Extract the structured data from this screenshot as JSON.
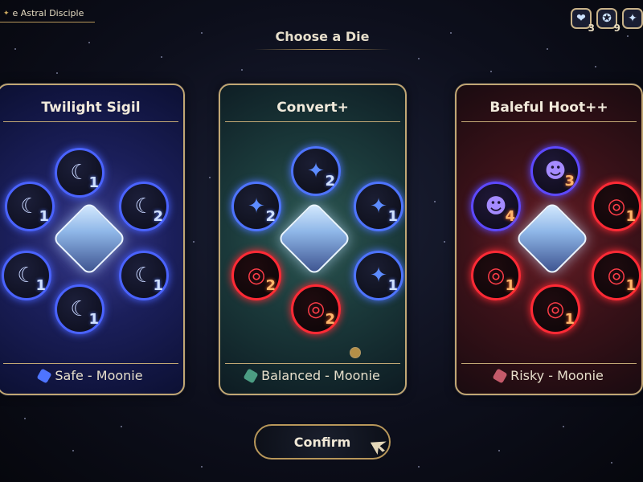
{
  "top_left_title": "e Astral Disciple",
  "resources": [
    {
      "icon": "heart-shield-icon",
      "count": "3"
    },
    {
      "icon": "coin-pouch-icon",
      "count": "9"
    },
    {
      "icon": "heart-gem-icon",
      "count": ""
    }
  ],
  "header": {
    "title": "Choose a Die"
  },
  "cards": [
    {
      "name": "Twilight Sigil",
      "footer": "Safe - Moonie",
      "faces": [
        {
          "type": "moon",
          "value": "1",
          "color": "blue"
        },
        {
          "type": "moon",
          "value": "1",
          "color": "blue"
        },
        {
          "type": "moon",
          "value": "2",
          "color": "blue"
        },
        {
          "type": "moon",
          "value": "1",
          "color": "blue"
        },
        {
          "type": "moon",
          "value": "1",
          "color": "blue"
        },
        {
          "type": "moon",
          "value": "1",
          "color": "blue"
        }
      ]
    },
    {
      "name": "Convert+",
      "footer": "Balanced - Moonie",
      "faces": [
        {
          "type": "gem",
          "value": "2",
          "color": "blue"
        },
        {
          "type": "gem",
          "value": "2",
          "color": "blue"
        },
        {
          "type": "gem",
          "value": "1",
          "color": "blue"
        },
        {
          "type": "red",
          "value": "2",
          "color": "orange"
        },
        {
          "type": "gem",
          "value": "1",
          "color": "blue"
        },
        {
          "type": "red",
          "value": "2",
          "color": "orange"
        }
      ]
    },
    {
      "name": "Baleful Hoot++",
      "footer": "Risky - Moonie",
      "faces": [
        {
          "type": "owl",
          "value": "3",
          "color": "orange"
        },
        {
          "type": "owl",
          "value": "4",
          "color": "orange"
        },
        {
          "type": "red",
          "value": "1",
          "color": "orange"
        },
        {
          "type": "red",
          "value": "1",
          "color": "orange"
        },
        {
          "type": "red",
          "value": "1",
          "color": "orange"
        },
        {
          "type": "red",
          "value": "1",
          "color": "orange"
        }
      ]
    }
  ],
  "confirm_label": "Confirm",
  "colors": {
    "gold": "#c1a774",
    "blue": "#4a63ff",
    "red": "#ff2a35",
    "card_mid_teal": "#2f5a55"
  }
}
